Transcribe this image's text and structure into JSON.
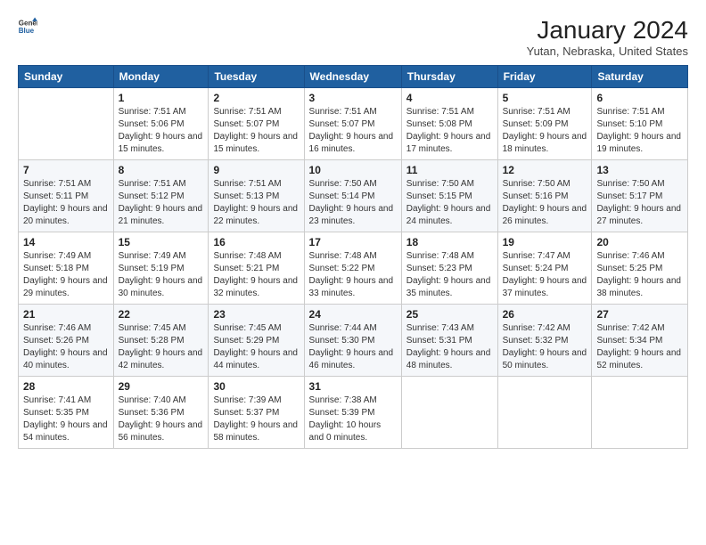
{
  "header": {
    "logo": {
      "general": "General",
      "blue": "Blue"
    },
    "title": "January 2024",
    "location": "Yutan, Nebraska, United States"
  },
  "weekdays": [
    "Sunday",
    "Monday",
    "Tuesday",
    "Wednesday",
    "Thursday",
    "Friday",
    "Saturday"
  ],
  "weeks": [
    [
      {
        "day": "",
        "sunrise": "",
        "sunset": "",
        "daylight": ""
      },
      {
        "day": "1",
        "sunrise": "Sunrise: 7:51 AM",
        "sunset": "Sunset: 5:06 PM",
        "daylight": "Daylight: 9 hours and 15 minutes."
      },
      {
        "day": "2",
        "sunrise": "Sunrise: 7:51 AM",
        "sunset": "Sunset: 5:07 PM",
        "daylight": "Daylight: 9 hours and 15 minutes."
      },
      {
        "day": "3",
        "sunrise": "Sunrise: 7:51 AM",
        "sunset": "Sunset: 5:07 PM",
        "daylight": "Daylight: 9 hours and 16 minutes."
      },
      {
        "day": "4",
        "sunrise": "Sunrise: 7:51 AM",
        "sunset": "Sunset: 5:08 PM",
        "daylight": "Daylight: 9 hours and 17 minutes."
      },
      {
        "day": "5",
        "sunrise": "Sunrise: 7:51 AM",
        "sunset": "Sunset: 5:09 PM",
        "daylight": "Daylight: 9 hours and 18 minutes."
      },
      {
        "day": "6",
        "sunrise": "Sunrise: 7:51 AM",
        "sunset": "Sunset: 5:10 PM",
        "daylight": "Daylight: 9 hours and 19 minutes."
      }
    ],
    [
      {
        "day": "7",
        "sunrise": "Sunrise: 7:51 AM",
        "sunset": "Sunset: 5:11 PM",
        "daylight": "Daylight: 9 hours and 20 minutes."
      },
      {
        "day": "8",
        "sunrise": "Sunrise: 7:51 AM",
        "sunset": "Sunset: 5:12 PM",
        "daylight": "Daylight: 9 hours and 21 minutes."
      },
      {
        "day": "9",
        "sunrise": "Sunrise: 7:51 AM",
        "sunset": "Sunset: 5:13 PM",
        "daylight": "Daylight: 9 hours and 22 minutes."
      },
      {
        "day": "10",
        "sunrise": "Sunrise: 7:50 AM",
        "sunset": "Sunset: 5:14 PM",
        "daylight": "Daylight: 9 hours and 23 minutes."
      },
      {
        "day": "11",
        "sunrise": "Sunrise: 7:50 AM",
        "sunset": "Sunset: 5:15 PM",
        "daylight": "Daylight: 9 hours and 24 minutes."
      },
      {
        "day": "12",
        "sunrise": "Sunrise: 7:50 AM",
        "sunset": "Sunset: 5:16 PM",
        "daylight": "Daylight: 9 hours and 26 minutes."
      },
      {
        "day": "13",
        "sunrise": "Sunrise: 7:50 AM",
        "sunset": "Sunset: 5:17 PM",
        "daylight": "Daylight: 9 hours and 27 minutes."
      }
    ],
    [
      {
        "day": "14",
        "sunrise": "Sunrise: 7:49 AM",
        "sunset": "Sunset: 5:18 PM",
        "daylight": "Daylight: 9 hours and 29 minutes."
      },
      {
        "day": "15",
        "sunrise": "Sunrise: 7:49 AM",
        "sunset": "Sunset: 5:19 PM",
        "daylight": "Daylight: 9 hours and 30 minutes."
      },
      {
        "day": "16",
        "sunrise": "Sunrise: 7:48 AM",
        "sunset": "Sunset: 5:21 PM",
        "daylight": "Daylight: 9 hours and 32 minutes."
      },
      {
        "day": "17",
        "sunrise": "Sunrise: 7:48 AM",
        "sunset": "Sunset: 5:22 PM",
        "daylight": "Daylight: 9 hours and 33 minutes."
      },
      {
        "day": "18",
        "sunrise": "Sunrise: 7:48 AM",
        "sunset": "Sunset: 5:23 PM",
        "daylight": "Daylight: 9 hours and 35 minutes."
      },
      {
        "day": "19",
        "sunrise": "Sunrise: 7:47 AM",
        "sunset": "Sunset: 5:24 PM",
        "daylight": "Daylight: 9 hours and 37 minutes."
      },
      {
        "day": "20",
        "sunrise": "Sunrise: 7:46 AM",
        "sunset": "Sunset: 5:25 PM",
        "daylight": "Daylight: 9 hours and 38 minutes."
      }
    ],
    [
      {
        "day": "21",
        "sunrise": "Sunrise: 7:46 AM",
        "sunset": "Sunset: 5:26 PM",
        "daylight": "Daylight: 9 hours and 40 minutes."
      },
      {
        "day": "22",
        "sunrise": "Sunrise: 7:45 AM",
        "sunset": "Sunset: 5:28 PM",
        "daylight": "Daylight: 9 hours and 42 minutes."
      },
      {
        "day": "23",
        "sunrise": "Sunrise: 7:45 AM",
        "sunset": "Sunset: 5:29 PM",
        "daylight": "Daylight: 9 hours and 44 minutes."
      },
      {
        "day": "24",
        "sunrise": "Sunrise: 7:44 AM",
        "sunset": "Sunset: 5:30 PM",
        "daylight": "Daylight: 9 hours and 46 minutes."
      },
      {
        "day": "25",
        "sunrise": "Sunrise: 7:43 AM",
        "sunset": "Sunset: 5:31 PM",
        "daylight": "Daylight: 9 hours and 48 minutes."
      },
      {
        "day": "26",
        "sunrise": "Sunrise: 7:42 AM",
        "sunset": "Sunset: 5:32 PM",
        "daylight": "Daylight: 9 hours and 50 minutes."
      },
      {
        "day": "27",
        "sunrise": "Sunrise: 7:42 AM",
        "sunset": "Sunset: 5:34 PM",
        "daylight": "Daylight: 9 hours and 52 minutes."
      }
    ],
    [
      {
        "day": "28",
        "sunrise": "Sunrise: 7:41 AM",
        "sunset": "Sunset: 5:35 PM",
        "daylight": "Daylight: 9 hours and 54 minutes."
      },
      {
        "day": "29",
        "sunrise": "Sunrise: 7:40 AM",
        "sunset": "Sunset: 5:36 PM",
        "daylight": "Daylight: 9 hours and 56 minutes."
      },
      {
        "day": "30",
        "sunrise": "Sunrise: 7:39 AM",
        "sunset": "Sunset: 5:37 PM",
        "daylight": "Daylight: 9 hours and 58 minutes."
      },
      {
        "day": "31",
        "sunrise": "Sunrise: 7:38 AM",
        "sunset": "Sunset: 5:39 PM",
        "daylight": "Daylight: 10 hours and 0 minutes."
      },
      {
        "day": "",
        "sunrise": "",
        "sunset": "",
        "daylight": ""
      },
      {
        "day": "",
        "sunrise": "",
        "sunset": "",
        "daylight": ""
      },
      {
        "day": "",
        "sunrise": "",
        "sunset": "",
        "daylight": ""
      }
    ]
  ]
}
